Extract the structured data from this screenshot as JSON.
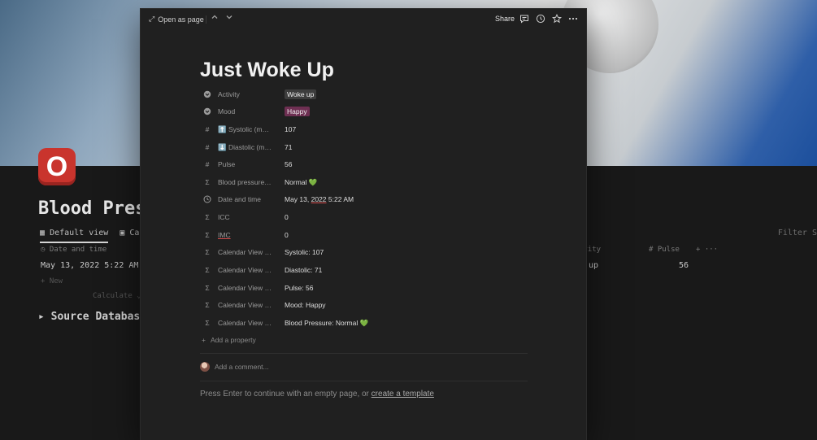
{
  "background": {
    "title": "Blood Pressu",
    "tabs": [
      {
        "label": "Default view",
        "icon": "table-icon"
      },
      {
        "label": "Calen",
        "icon": "calendar-icon"
      }
    ],
    "filter": "Filter S",
    "columns": {
      "date": "Date and time",
      "activity": "ivity",
      "pulse": "Pulse"
    },
    "row": {
      "date": "May 13, 2022 5:22 AM",
      "activity": "up",
      "pulse": "56"
    },
    "new_label": "+ New",
    "calculate_label": "Calculate ⌄",
    "source_db": "Source Database (",
    "icon_letter": "O"
  },
  "modal": {
    "topbar": {
      "open_as_page": "Open as page",
      "share": "Share"
    },
    "title": "Just Woke Up",
    "properties": [
      {
        "icon": "select-icon",
        "name": "Activity",
        "value": "Woke up",
        "tag_color": "#3d3d3d"
      },
      {
        "icon": "select-icon",
        "name": "Mood",
        "value": "Happy",
        "tag_color": "#6e2f52"
      },
      {
        "icon": "number-icon",
        "name": "⬆️ Systolic (mm …",
        "value": "107"
      },
      {
        "icon": "number-icon",
        "name": "⬇️ Diastolic (mm …",
        "value": "71"
      },
      {
        "icon": "number-icon",
        "name": "Pulse",
        "value": "56"
      },
      {
        "icon": "formula-icon",
        "name": "Blood pressure c…",
        "value": "Normal 💚"
      },
      {
        "icon": "clock-icon",
        "name": "Date and time",
        "value_parts": [
          "May 13, ",
          "2022",
          " 5:22 AM"
        ]
      },
      {
        "icon": "formula-icon",
        "name": "ICC",
        "value": "0"
      },
      {
        "icon": "formula-icon",
        "name": "IMC",
        "value": "0"
      },
      {
        "icon": "formula-icon",
        "name": "Calendar View Sy…",
        "value": "Systolic: 107"
      },
      {
        "icon": "formula-icon",
        "name": "Calendar View Di…",
        "value": "Diastolic: 71"
      },
      {
        "icon": "formula-icon",
        "name": "Calendar View P…",
        "value": "Pulse: 56"
      },
      {
        "icon": "formula-icon",
        "name": "Calendar View M…",
        "value": "Mood: Happy"
      },
      {
        "icon": "formula-icon",
        "name": "Calendar View Bl…",
        "value": "Blood Pressure: Normal 💚"
      }
    ],
    "add_property": "Add a property",
    "add_comment": "Add a comment...",
    "empty_prompt": "Press Enter to continue with an empty page, or ",
    "create_template": "create a template"
  }
}
